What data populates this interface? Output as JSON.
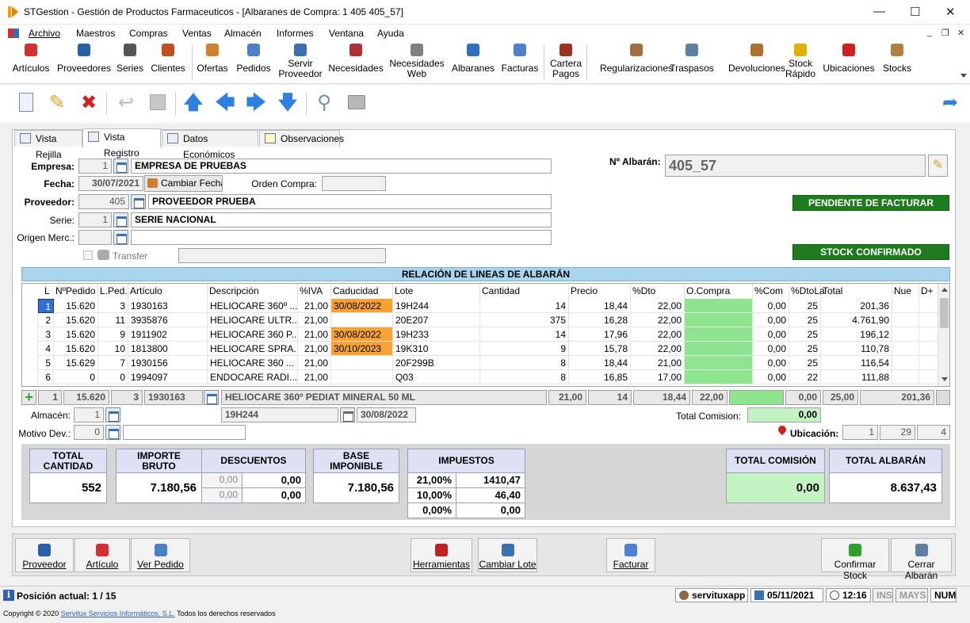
{
  "window": {
    "title": "STGestion - Gestión de Productos Farmaceuticos - [Albaranes de Compra: 1 405 405_57]",
    "minimize": "—",
    "maximize": "☐",
    "close": "✕",
    "mdi_min": "_",
    "mdi_restore": "❐",
    "mdi_close": "✕"
  },
  "menu": [
    "Archivo",
    "Maestros",
    "Compras",
    "Ventas",
    "Almacén",
    "Informes",
    "Ventana",
    "Ayuda"
  ],
  "ribbon": [
    {
      "label": "Artículos",
      "icon": "articles-icon",
      "color": "#d03030"
    },
    {
      "label": "Proveedores",
      "icon": "supplier-icon",
      "color": "#2a5fa8"
    },
    {
      "label": "Series",
      "icon": "series-icon",
      "color": "#555555"
    },
    {
      "label": "Clientes",
      "icon": "clients-icon",
      "color": "#c05020"
    },
    {
      "label": "Ofertas",
      "icon": "offers-icon",
      "color": "#d08030"
    },
    {
      "label": "Pedidos",
      "icon": "orders-icon",
      "color": "#4a80c8"
    },
    {
      "label": "Servir\nProveedor",
      "icon": "serve-supplier-icon",
      "color": "#3a6fb0"
    },
    {
      "label": "Necesidades",
      "icon": "needs-icon",
      "color": "#b03030"
    },
    {
      "label": "Necesidades\nWeb",
      "icon": "needs-web-icon",
      "color": "#808080"
    },
    {
      "label": "Albaranes",
      "icon": "delivery-notes-icon",
      "color": "#3070c0"
    },
    {
      "label": "Facturas",
      "icon": "invoices-icon",
      "color": "#5080d0"
    },
    {
      "label": "Cartera\nPagos",
      "icon": "payments-icon",
      "color": "#a03020"
    },
    {
      "label": "Regularizaciones",
      "icon": "adjustments-icon",
      "color": "#a07040"
    },
    {
      "label": "Traspasos",
      "icon": "transfers-icon",
      "color": "#6080a0"
    },
    {
      "label": "Devoluciones",
      "icon": "returns-icon",
      "color": "#b07030"
    },
    {
      "label": "Stock\nRápido",
      "icon": "quick-stock-icon",
      "color": "#e0b000"
    },
    {
      "label": "Ubicaciones",
      "icon": "locations-icon",
      "color": "#d02020"
    },
    {
      "label": "Stocks",
      "icon": "stocks-icon",
      "color": "#b08040"
    }
  ],
  "tabs": [
    "Vista Rejilla",
    "Vista Registro",
    "Datos Económicos",
    "Observaciones"
  ],
  "form": {
    "empresa_label": "Empresa:",
    "empresa_code": "1",
    "empresa_name": "EMPRESA DE PRUEBAS",
    "fecha_label": "Fecha:",
    "fecha": "30/07/2021",
    "cambiar_fecha": "Cambiar Fecha",
    "orden_compra_label": "Orden Compra:",
    "orden_compra": "",
    "proveedor_label": "Proveedor:",
    "proveedor_code": "405",
    "proveedor_name": "PROVEEDOR PRUEBA",
    "serie_label": "Serie:",
    "serie_code": "1",
    "serie_name": "SERIE NACIONAL",
    "origen_label": "Origen Merc.:",
    "origen_code": "",
    "origen_name": "",
    "transfer_label": "Transfer",
    "albaran_label": "Nº Albarán:",
    "albaran": "405_57",
    "status1": "PENDIENTE DE FACTURAR",
    "status2": "STOCK CONFIRMADO"
  },
  "lines_title": "RELACIÓN DE LINEAS DE ALBARÁN",
  "columns": [
    "L",
    "NºPedido",
    "L.Ped.",
    "Artículo",
    "Descripción",
    "%IVA",
    "Caducidad",
    "Lote",
    "Cantidad",
    "Precio",
    "%Dto",
    "O.Compra",
    "%Com",
    "%DtoLa",
    "Total",
    "Nue",
    "D+"
  ],
  "rows": [
    {
      "l": "1",
      "pedido": "15.620",
      "lped": "3",
      "art": "1930163",
      "desc": "HELIOCARE 360º ...",
      "iva": "21,00",
      "cad": "30/08/2022",
      "lote": "19H244",
      "cant": "14",
      "precio": "18,44",
      "dto": "22,00",
      "oc": "",
      "com": "0,00",
      "dtola": "25",
      "total": "201,36"
    },
    {
      "l": "2",
      "pedido": "15.620",
      "lped": "11",
      "art": "3935876",
      "desc": "HELIOCARE ULTR...",
      "iva": "21,00",
      "cad": "",
      "lote": "20E207",
      "cant": "375",
      "precio": "16,28",
      "dto": "22,00",
      "oc": "",
      "com": "0,00",
      "dtola": "25",
      "total": "4.761,90"
    },
    {
      "l": "3",
      "pedido": "15.620",
      "lped": "9",
      "art": "1911902",
      "desc": "HELIOCARE 360 P...",
      "iva": "21,00",
      "cad": "30/08/2022",
      "lote": "19H233",
      "cant": "14",
      "precio": "17,96",
      "dto": "22,00",
      "oc": "",
      "com": "0,00",
      "dtola": "25",
      "total": "196,12"
    },
    {
      "l": "4",
      "pedido": "15.620",
      "lped": "10",
      "art": "1813800",
      "desc": "HELIOCARE SPRA...",
      "iva": "21,00",
      "cad": "30/10/2023",
      "lote": "19K310",
      "cant": "9",
      "precio": "15,78",
      "dto": "22,00",
      "oc": "",
      "com": "0,00",
      "dtola": "25",
      "total": "110,78"
    },
    {
      "l": "5",
      "pedido": "15.629",
      "lped": "7",
      "art": "1930156",
      "desc": "HELIOCARE 360 ...",
      "iva": "21,00",
      "cad": "",
      "lote": "20F299B",
      "cant": "8",
      "precio": "18,44",
      "dto": "21,00",
      "oc": "",
      "com": "0,00",
      "dtola": "25",
      "total": "116,54"
    },
    {
      "l": "6",
      "pedido": "0",
      "lped": "0",
      "art": "1994097",
      "desc": "ENDOCARE RADI...",
      "iva": "21,00",
      "cad": "",
      "lote": "Q03",
      "cant": "8",
      "precio": "16,85",
      "dto": "17,00",
      "oc": "",
      "com": "0,00",
      "dtola": "22",
      "total": "111,88"
    }
  ],
  "edit": {
    "l": "1",
    "pedido": "15.620",
    "lped": "3",
    "art": "1930163",
    "desc": "HELIOCARE 360º PEDIAT MINERAL 50 ML",
    "iva": "21,00",
    "cant": "14",
    "precio": "18,44",
    "dto": "22,00",
    "oc": "",
    "com": "0,00",
    "dtola": "25,00",
    "total": "201,36",
    "lote": "19H244",
    "cad": "30/08/2022"
  },
  "almacen_label": "Almacén:",
  "almacen": "1",
  "motivo_label": "Motivo Dev.:",
  "motivo": "0",
  "motivo_text": "",
  "total_comision_label": "Total Comision:",
  "total_comision": "0,00",
  "ubicacion_label": "Ubicación:",
  "ubicacion": [
    "1",
    "29",
    "4"
  ],
  "summary": {
    "total_cantidad_label": "TOTAL\nCANTIDAD",
    "total_cantidad": "552",
    "importe_bruto_label": "IMPORTE\nBRUTO",
    "importe_bruto": "7.180,56",
    "descuentos_label": "DESCUENTOS",
    "desc1_pct": "0,00",
    "desc1": "0,00",
    "desc2_pct": "0,00",
    "desc2": "0,00",
    "base_label": "BASE\nIMPONIBLE",
    "base": "7.180,56",
    "impuestos_label": "IMPUESTOS",
    "imp": [
      {
        "pct": "21,00%",
        "val": "1410,47"
      },
      {
        "pct": "10,00%",
        "val": "46,40"
      },
      {
        "pct": "0,00%",
        "val": "0,00"
      }
    ],
    "total_comision_label": "TOTAL COMISIÓN",
    "total_comision": "0,00",
    "total_albaran_label": "TOTAL ALBARÁN",
    "total_albaran": "8.637,43"
  },
  "bottom_buttons": [
    {
      "label": "Proveedor",
      "name": "proveedor-button",
      "icon": "supplier-icon",
      "color": "#2a5fa8"
    },
    {
      "label": "Artículo",
      "name": "articulo-button",
      "icon": "article-icon",
      "color": "#d03030"
    },
    {
      "label": "Ver Pedido",
      "name": "ver-pedido-button",
      "icon": "order-icon",
      "color": "#4a80c8"
    },
    {
      "label": "Herramientas",
      "name": "herramientas-button",
      "icon": "toolbox-icon",
      "color": "#c02020"
    },
    {
      "label": "Cambiar Lote",
      "name": "cambiar-lote-button",
      "icon": "calendar-icon",
      "color": "#3a6fb0"
    },
    {
      "label": "Facturar",
      "name": "facturar-button",
      "icon": "invoice-icon",
      "color": "#5080d0"
    },
    {
      "label": "Confirmar Stock",
      "name": "confirmar-stock-button",
      "icon": "check-icon",
      "color": "#2ea02e"
    },
    {
      "label": "Cerrar Albarán",
      "name": "cerrar-albaran-button",
      "icon": "close-document-icon",
      "color": "#6080a0"
    }
  ],
  "status": {
    "position": "Posición actual: 1 / 15",
    "user": "servituxapp",
    "date": "05/11/2021",
    "time": "12:16",
    "ins": "INS",
    "mays": "MAYS",
    "num": "NUM"
  },
  "copyright": {
    "pre": "Copyright © 2020",
    "link": "Servitux Servicios Informáticos, S.L.",
    "post": "Todos los derechos reservados"
  }
}
